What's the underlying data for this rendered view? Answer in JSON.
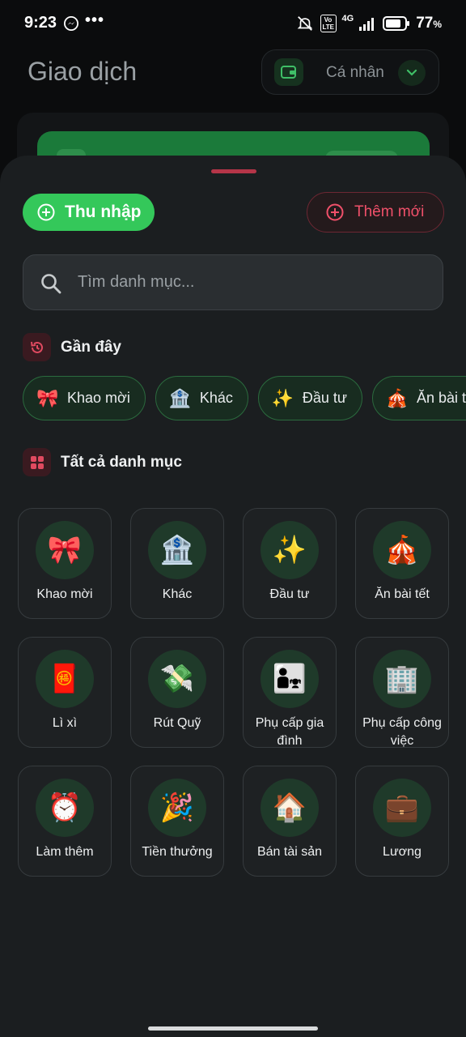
{
  "status_bar": {
    "time": "9:23",
    "more": "•••",
    "battery": "77",
    "battery_unit": "%",
    "network": "4G",
    "volte": "Vo LTE"
  },
  "header": {
    "title": "Giao dịch",
    "account_label": "Cá nhân"
  },
  "sheet": {
    "income_label": "Thu nhập",
    "add_new_label": "Thêm mới",
    "search_placeholder": "Tìm danh mục...",
    "recent_title": "Gần đây",
    "all_title": "Tất cả danh mục",
    "recent": [
      {
        "label": "Khao mời",
        "icon": "bow-icon",
        "emoji": "🎀"
      },
      {
        "label": "Khác",
        "icon": "bank-icon",
        "emoji": "🏦"
      },
      {
        "label": "Đầu tư",
        "icon": "sparkles-icon",
        "emoji": "✨"
      },
      {
        "label": "Ăn bài tết",
        "icon": "circus-tent-icon",
        "emoji": "🎪"
      }
    ],
    "categories": [
      {
        "label": "Khao mời",
        "icon": "bow-icon",
        "emoji": "🎀"
      },
      {
        "label": "Khác",
        "icon": "bank-icon",
        "emoji": "🏦"
      },
      {
        "label": "Đầu tư",
        "icon": "sparkles-icon",
        "emoji": "✨"
      },
      {
        "label": "Ăn bài tết",
        "icon": "circus-tent-icon",
        "emoji": "🎪"
      },
      {
        "label": "Lì xì",
        "icon": "red-envelope-icon",
        "emoji": "🧧"
      },
      {
        "label": "Rút Quỹ",
        "icon": "money-wings-icon",
        "emoji": "💸"
      },
      {
        "label": "Phụ cấp gia đình",
        "icon": "family-icon",
        "emoji": "👨‍👧"
      },
      {
        "label": "Phụ cấp công việc",
        "icon": "office-building-icon",
        "emoji": "🏢"
      },
      {
        "label": "Làm thêm",
        "icon": "alarm-clock-icon",
        "emoji": "⏰"
      },
      {
        "label": "Tiền thưởng",
        "icon": "party-popper-icon",
        "emoji": "🎉"
      },
      {
        "label": "Bán tài sản",
        "icon": "house-icon",
        "emoji": "🏠"
      },
      {
        "label": "Lương",
        "icon": "briefcase-icon",
        "emoji": "💼"
      }
    ]
  },
  "colors": {
    "income_green": "#34c85a",
    "accent_red": "#f0506a",
    "sheet_bg": "#1b1e20"
  }
}
